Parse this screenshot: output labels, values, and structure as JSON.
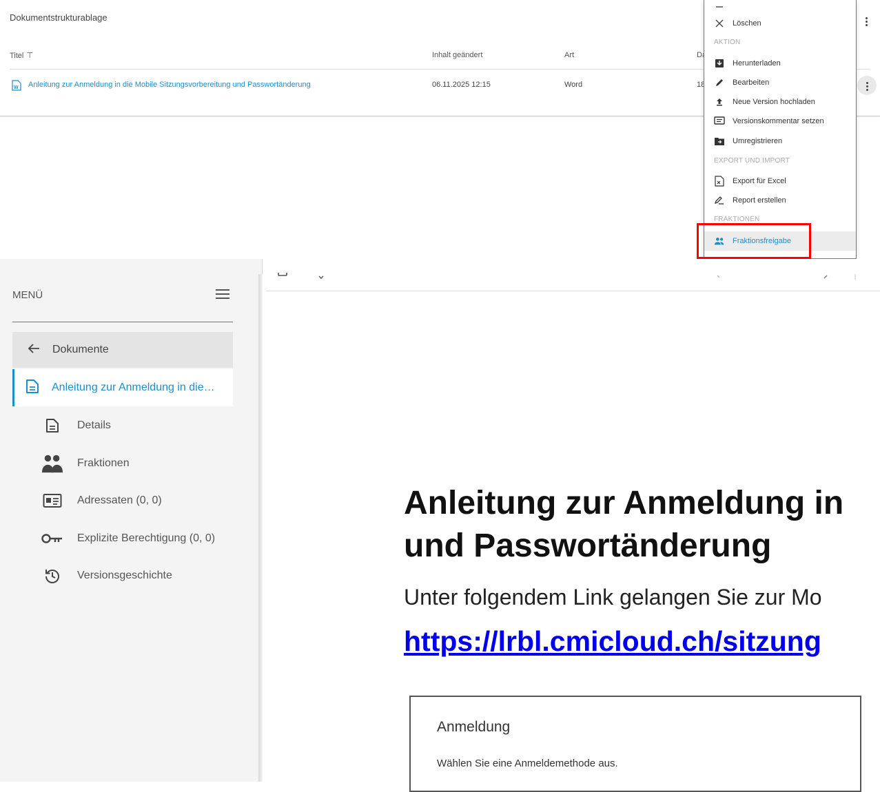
{
  "top": {
    "title": "Dokumentstrukturablage",
    "columns": {
      "titel": "Titel",
      "inhalt": "Inhalt geändert",
      "art": "Art",
      "da": "Da"
    },
    "row": {
      "title": "Anleitung zur Anmeldung in die Mobile Sitzungsvorbereitung und Passwortänderung",
      "date": "06.11.2025 12:15",
      "art": "Word",
      "partial": "18"
    }
  },
  "context_menu": {
    "items_top": [
      {
        "label": "Löschen",
        "icon": "close-icon"
      }
    ],
    "section_aktion": "AKTION",
    "items_aktion": [
      {
        "label": "Herunterladen",
        "icon": "download-icon"
      },
      {
        "label": "Bearbeiten",
        "icon": "pencil-icon"
      },
      {
        "label": "Neue Version hochladen",
        "icon": "upload-icon"
      },
      {
        "label": "Versionskommentar setzen",
        "icon": "comment-icon"
      },
      {
        "label": "Umregistrieren",
        "icon": "folder-move-icon"
      }
    ],
    "section_export": "EXPORT UND IMPORT",
    "items_export": [
      {
        "label": "Export für Excel",
        "icon": "excel-export-icon"
      },
      {
        "label": "Report erstellen",
        "icon": "report-icon"
      }
    ],
    "section_fraktionen": "FRAKTIONEN",
    "items_fraktionen": [
      {
        "label": "Fraktionsfreigabe",
        "icon": "people-icon"
      }
    ]
  },
  "sidebar": {
    "menu_title": "MENÜ",
    "back_label": "Dokumente",
    "current_label": "Anleitung zur Anmeldung in die…",
    "items": [
      {
        "label": "Details",
        "icon": "document-icon"
      },
      {
        "label": "Fraktionen",
        "icon": "group-icon"
      },
      {
        "label": "Adressaten (0, 0)",
        "icon": "contact-card-icon"
      },
      {
        "label": "Explizite Berechtigung (0, 0)",
        "icon": "key-icon"
      },
      {
        "label": "Versionsgeschichte",
        "icon": "history-icon"
      }
    ]
  },
  "document": {
    "heading_line1": "Anleitung zur Anmeldung in",
    "heading_line2": "und Passwortänderung",
    "text": "Unter folgendem Link gelangen Sie zur Mo",
    "link": "https://lrbl.cmicloud.ch/sitzung",
    "login_title": "Anmeldung",
    "login_sub": "Wählen Sie eine Anmeldemethode aus."
  },
  "colors": {
    "accent": "#1a8fcc",
    "highlight": "#ff0000",
    "link": "#0000ee"
  }
}
